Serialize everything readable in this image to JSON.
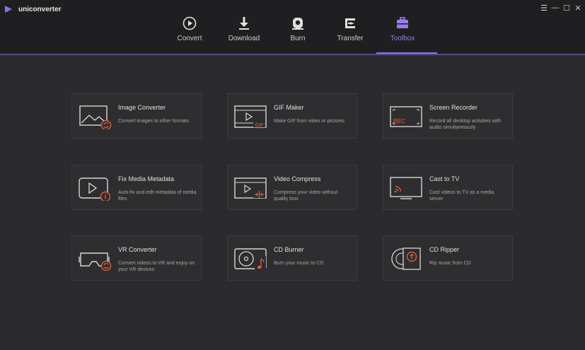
{
  "app": {
    "name": "uniconverter",
    "accent": "#8e6fe8",
    "highlight": "#e5623c"
  },
  "window_controls": [
    {
      "name": "menu-icon",
      "glyph": "☰"
    },
    {
      "name": "minimize-icon",
      "glyph": "—"
    },
    {
      "name": "maximize-icon",
      "glyph": "☐"
    },
    {
      "name": "close-icon",
      "glyph": "✕"
    }
  ],
  "tabs": [
    {
      "label": "Convert",
      "icon": "convert-icon"
    },
    {
      "label": "Download",
      "icon": "download-icon"
    },
    {
      "label": "Burn",
      "icon": "burn-icon"
    },
    {
      "label": "Transfer",
      "icon": "transfer-icon"
    },
    {
      "label": "Toolbox",
      "icon": "toolbox-icon",
      "active": true
    }
  ],
  "tools": [
    {
      "title": "Image Converter",
      "desc": "Convert images to other formats",
      "icon": "image-converter-icon"
    },
    {
      "title": "GIF Maker",
      "desc": "Make GIF from video or pictures",
      "icon": "gif-maker-icon",
      "icon_text": "GIF"
    },
    {
      "title": "Screen Recorder",
      "desc": "Record all desktop activities with audio simultaneously",
      "icon": "screen-recorder-icon",
      "icon_text": "REC"
    },
    {
      "title": "Fix Media Metadata",
      "desc": "Auto-fix and edit metadata of media files",
      "icon": "fix-metadata-icon"
    },
    {
      "title": "Video Compress",
      "desc": "Compress your video without quality loss",
      "icon": "video-compress-icon"
    },
    {
      "title": "Cast to TV",
      "desc": "Cast videos to TV as a media server",
      "icon": "cast-tv-icon"
    },
    {
      "title": "VR Converter",
      "desc": "Convert videos to VR and enjoy on your VR devices",
      "icon": "vr-converter-icon"
    },
    {
      "title": "CD Burner",
      "desc": "Burn your music to CD",
      "icon": "cd-burner-icon"
    },
    {
      "title": "CD Ripper",
      "desc": "Rip music from CD",
      "icon": "cd-ripper-icon"
    }
  ]
}
